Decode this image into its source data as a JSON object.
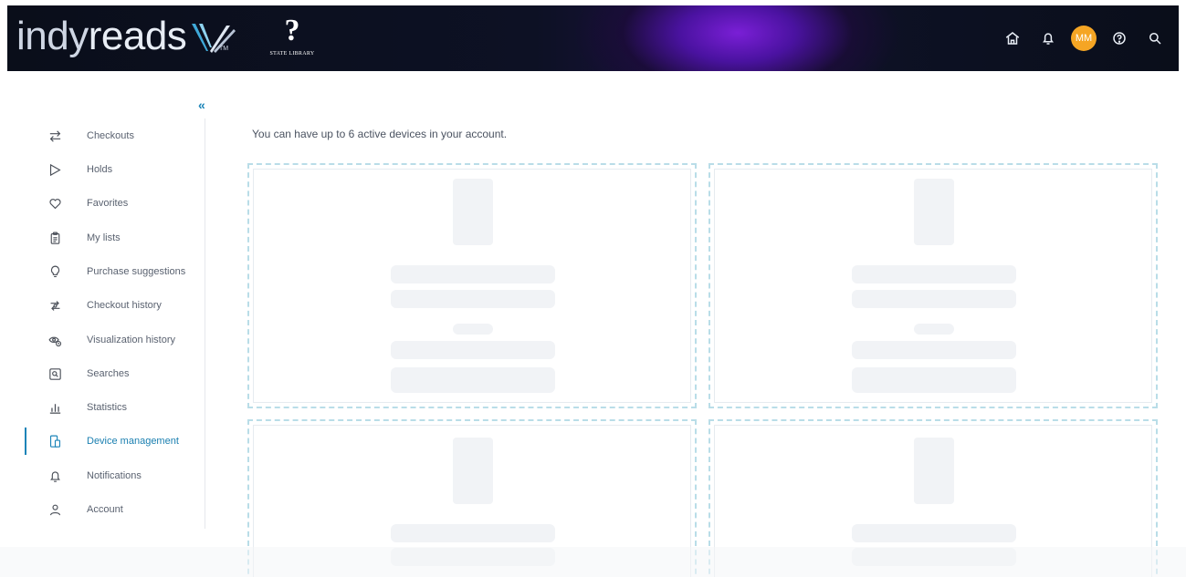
{
  "header": {
    "brand_light": "indy",
    "brand_bold": "reads",
    "brand_tm": "TM",
    "partner_glyph": "?",
    "partner_name": "STATE LIBRARY",
    "avatar_initials": "MM",
    "icons": [
      "home-icon",
      "bell-icon",
      "help-icon",
      "search-icon"
    ]
  },
  "sidebar": {
    "collapse_label": "«",
    "items": [
      {
        "label": "Checkouts",
        "icon": "swap-arrows-icon"
      },
      {
        "label": "Holds",
        "icon": "flag-outline-icon"
      },
      {
        "label": "Favorites",
        "icon": "heart-icon"
      },
      {
        "label": "My lists",
        "icon": "clipboard-list-icon"
      },
      {
        "label": "Purchase suggestions",
        "icon": "lightbulb-icon"
      },
      {
        "label": "Checkout history",
        "icon": "history-refresh-icon"
      },
      {
        "label": "Visualization history",
        "icon": "eye-history-icon"
      },
      {
        "label": "Searches",
        "icon": "search-box-icon"
      },
      {
        "label": "Statistics",
        "icon": "bar-chart-icon"
      },
      {
        "label": "Device management",
        "icon": "devices-icon",
        "active": true
      },
      {
        "label": "Notifications",
        "icon": "bell-icon"
      },
      {
        "label": "Account",
        "icon": "user-icon"
      }
    ]
  },
  "main": {
    "intro_text": "You can have up to 6 active devices in your account.",
    "device_slots_visible": 4
  },
  "colors": {
    "accent": "#1a84b8",
    "avatar": "#f5a524",
    "header_bg": "#0a0e1a",
    "header_glow": "#7a1fd6",
    "card_border": "#b9dde8",
    "skeleton": "#f1f3f6"
  }
}
